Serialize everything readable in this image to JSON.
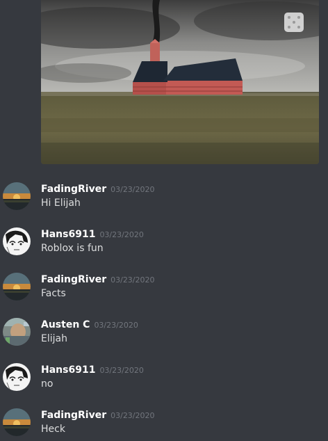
{
  "attachment": {
    "kind": "game-screenshot",
    "scene": "brick-church-with-smoking-chimney"
  },
  "messages": [
    {
      "username": "FadingRiver",
      "timestamp": "03/23/2020",
      "text": "Hi Elijah",
      "avatar": "sunset-avatar"
    },
    {
      "username": "Hans6911",
      "timestamp": "03/23/2020",
      "text": "Roblox is fun",
      "avatar": "anime-sketch-avatar"
    },
    {
      "username": "FadingRiver",
      "timestamp": "03/23/2020",
      "text": "Facts",
      "avatar": "sunset-avatar"
    },
    {
      "username": "Austen C",
      "timestamp": "03/23/2020",
      "text": "Elijah",
      "avatar": "blurry-photo-avatar"
    },
    {
      "username": "Hans6911",
      "timestamp": "03/23/2020",
      "text": "no",
      "avatar": "anime-sketch-avatar"
    },
    {
      "username": "FadingRiver",
      "timestamp": "03/23/2020",
      "text": "Heck",
      "avatar": "sunset-avatar"
    }
  ],
  "colors": {
    "background": "#36393f",
    "username": "#ffffff",
    "timestamp": "#72767d",
    "message_text": "#dcddde"
  }
}
